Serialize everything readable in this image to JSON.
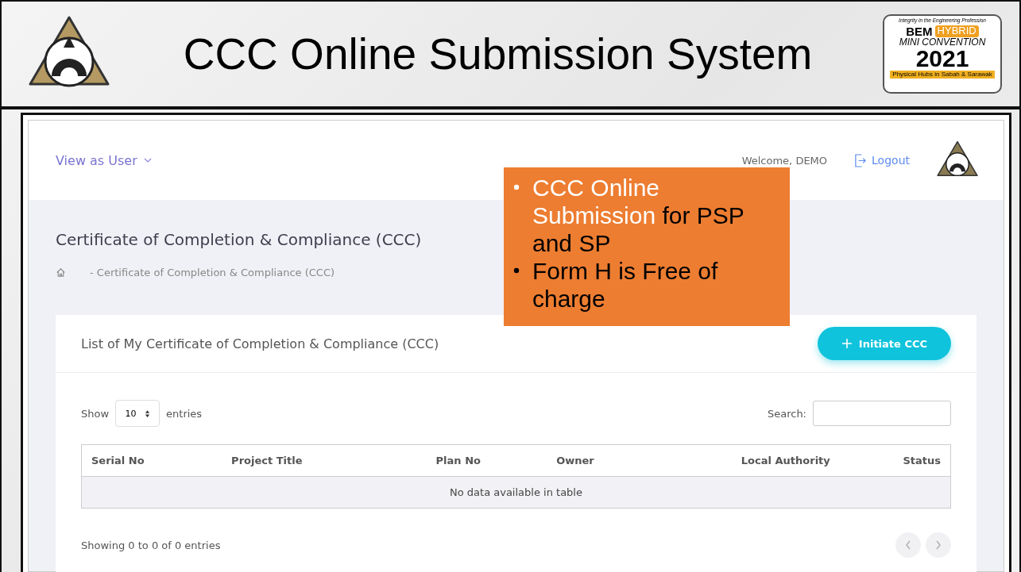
{
  "slide": {
    "title": "CCC Online Submission System",
    "badge": {
      "tagline": "Integrity in the Engineering Profession",
      "brand": "BEM",
      "hybrid": "HYBRID",
      "event": "MINI CONVENTION",
      "year": "2021",
      "footer": "Physical Hubs in Sabah & Sarawak"
    }
  },
  "topbar": {
    "view_menu": "View as User",
    "welcome": "Welcome, DEMO",
    "logout": "Logout"
  },
  "page": {
    "title": "Certificate of Completion & Compliance (CCC)",
    "breadcrumb": "-  Certificate of Completion & Compliance (CCC)"
  },
  "card": {
    "title": "List of My Certificate of Completion & Compliance (CCC)",
    "action": "Initiate CCC",
    "show_label": "Show",
    "page_size": "10",
    "entries_label": "entries",
    "search_label": "Search:",
    "columns": [
      "Serial No",
      "Project Title",
      "Plan No",
      "Owner",
      "Local Authority",
      "Status"
    ],
    "empty": "No data available in table",
    "info": "Showing 0 to 0 of 0 entries"
  },
  "callout": {
    "bullets": [
      [
        {
          "text": "CCC Online Submission",
          "kind": "highlight"
        },
        {
          "text": " for ",
          "kind": "plain"
        },
        {
          "text": "PSP",
          "kind": "strong"
        },
        {
          "text": " and ",
          "kind": "plain"
        },
        {
          "text": "SP",
          "kind": "strong"
        }
      ],
      [
        {
          "text": "Form H",
          "kind": "strong"
        },
        {
          "text": " is ",
          "kind": "plain"
        },
        {
          "text": "Free of charge",
          "kind": "strong"
        }
      ]
    ]
  }
}
